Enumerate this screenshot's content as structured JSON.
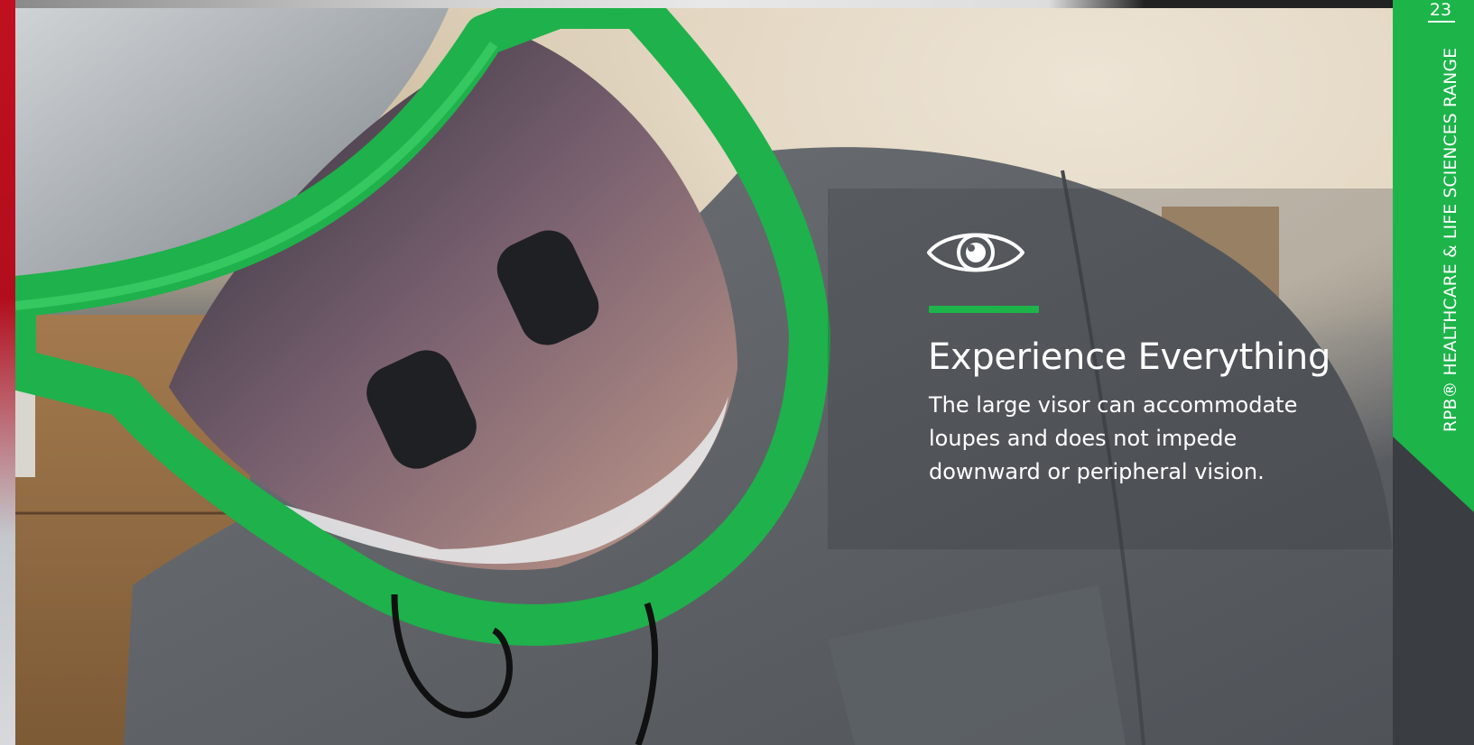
{
  "page": {
    "number": "23",
    "section_title": "RPB® HEALTHCARE & LIFE SCIENCES RANGE"
  },
  "feature": {
    "icon": "eye-icon",
    "heading": "Experience Everything",
    "body": "The large visor can accommodate loupes and does not impede downward or peripheral vision."
  },
  "colors": {
    "brand_green": "#1db44a",
    "left_edge_red": "#c01020",
    "text": "#ffffff"
  }
}
